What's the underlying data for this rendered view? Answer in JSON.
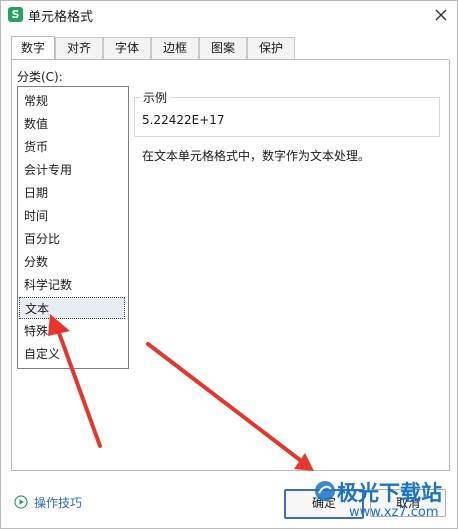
{
  "dialog": {
    "title": "单元格格式",
    "app_icon": "S",
    "close_icon": "close-icon"
  },
  "tabs": [
    {
      "label": "数字",
      "active": true
    },
    {
      "label": "对齐",
      "active": false
    },
    {
      "label": "字体",
      "active": false
    },
    {
      "label": "边框",
      "active": false
    },
    {
      "label": "图案",
      "active": false
    },
    {
      "label": "保护",
      "active": false
    }
  ],
  "category": {
    "label": "分类(C):",
    "items": [
      "常规",
      "数值",
      "货币",
      "会计专用",
      "日期",
      "时间",
      "百分比",
      "分数",
      "科学记数",
      "文本",
      "特殊",
      "自定义"
    ],
    "selected": "文本"
  },
  "sample": {
    "label": "示例",
    "value": "5.22422E+17"
  },
  "description": "在文本单元格格式中，数字作为文本处理。",
  "footer": {
    "tips_label": "操作技巧",
    "ok_label": "确定",
    "cancel_label": "取消"
  },
  "watermark": {
    "title": "极光下载站",
    "url": "www.xz7.com"
  },
  "colors": {
    "arrow": "#e8352b",
    "accent": "#3b6fbf",
    "app_icon": "#22a45d"
  }
}
